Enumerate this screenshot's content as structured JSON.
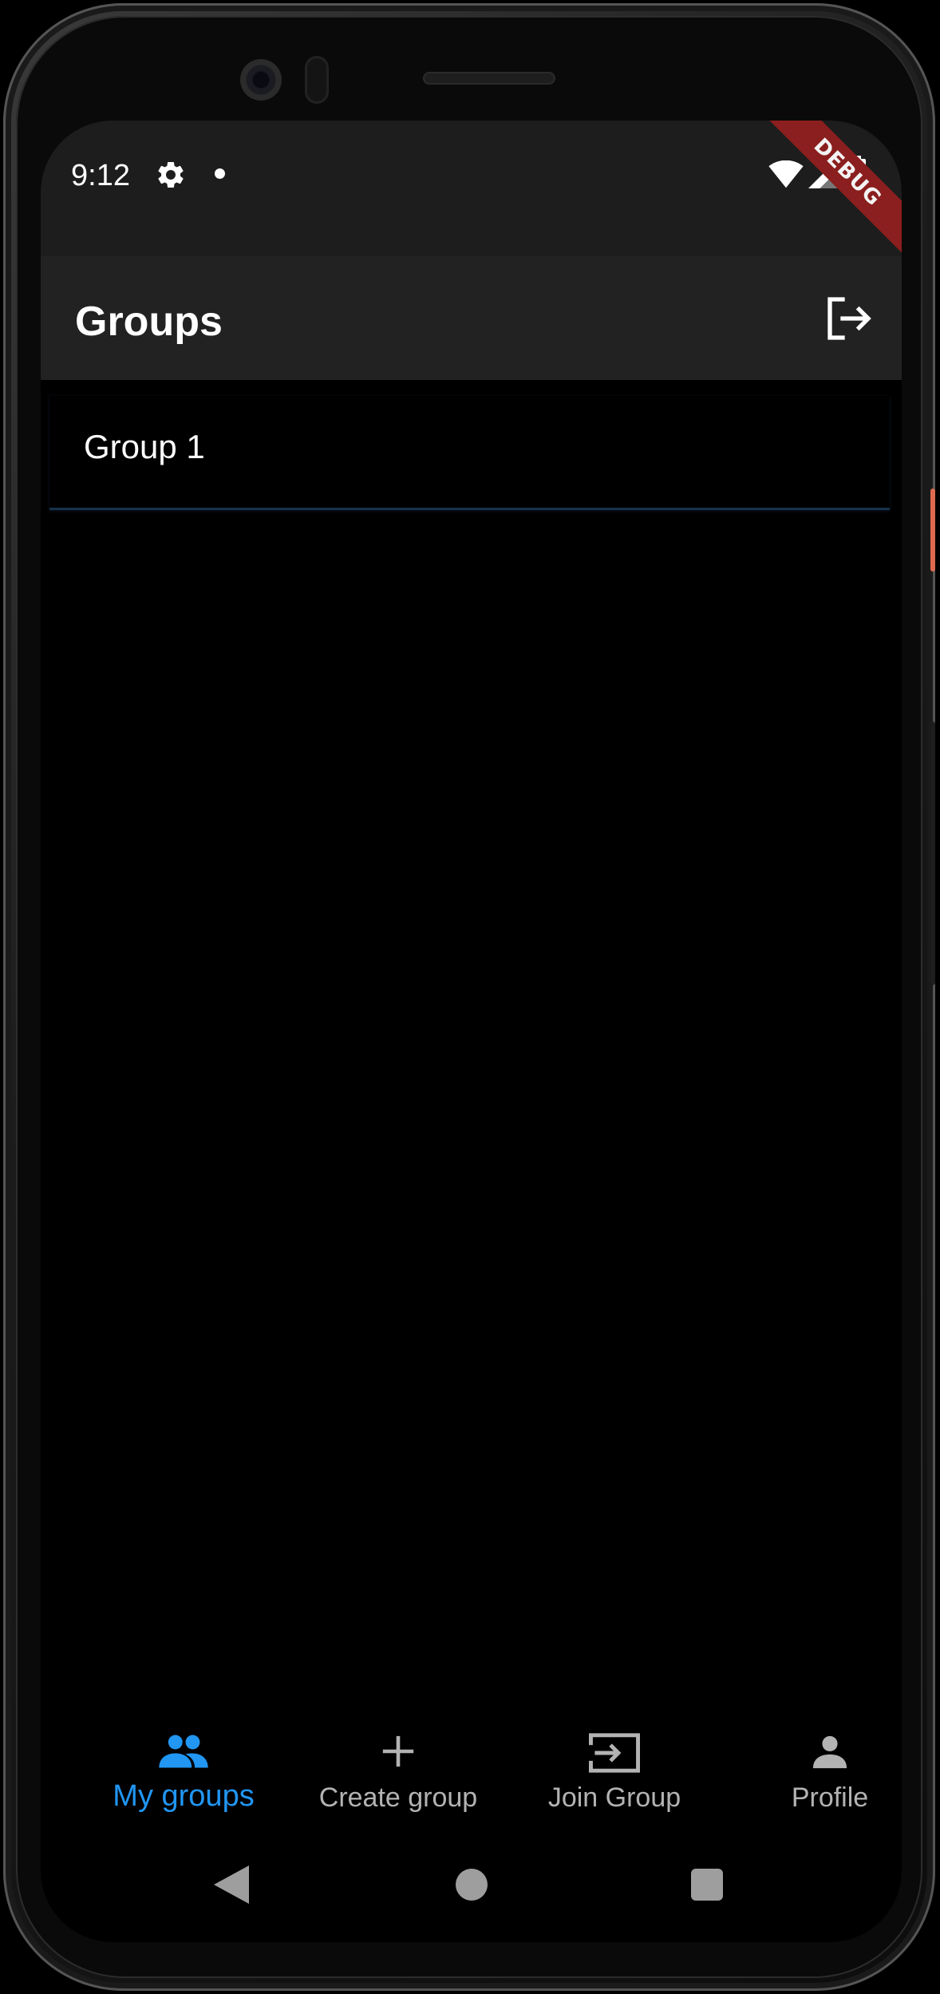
{
  "status_bar": {
    "time": "9:12",
    "icons": [
      "gear-icon",
      "notification-dot-icon",
      "wifi-icon",
      "signal-icon",
      "battery-icon"
    ],
    "debug_banner": "DEBUG"
  },
  "app_bar": {
    "title": "Groups",
    "action_icon": "logout-icon"
  },
  "groups": [
    {
      "name": "Group 1"
    }
  ],
  "bottom_nav": {
    "active_index": 0,
    "accent_color": "#2196f3",
    "items": [
      {
        "label": "My groups",
        "icon": "groups-icon"
      },
      {
        "label": "Create group",
        "icon": "plus-icon"
      },
      {
        "label": "Join Group",
        "icon": "join-icon"
      },
      {
        "label": "Profile",
        "icon": "person-icon"
      }
    ]
  },
  "system_nav": {
    "icons": [
      "back-icon",
      "home-icon",
      "recents-icon"
    ]
  }
}
